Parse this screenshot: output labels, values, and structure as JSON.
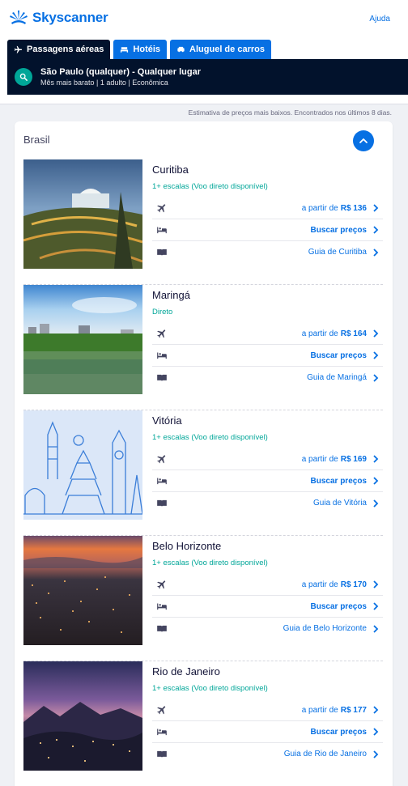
{
  "header": {
    "brand": "Skyscanner",
    "help_label": "Ajuda"
  },
  "tabs": [
    {
      "label": "Passagens aéreas",
      "icon": "plane-icon",
      "active": true
    },
    {
      "label": "Hotéis",
      "icon": "bed-icon",
      "active": false
    },
    {
      "label": "Aluguel de carros",
      "icon": "car-icon",
      "active": false
    }
  ],
  "search": {
    "route": "São Paulo (qualquer) - Qualquer lugar",
    "meta": "Mês mais barato | 1 adulto | Econômica"
  },
  "estimate_note": "Estimativa de preços mais baixos. Encontrados nos últimos 8 dias.",
  "country": "Brasil",
  "destinations": [
    {
      "city": "Curitiba",
      "stops": "1+ escalas (Voo direto disponível)",
      "price_prefix": "a partir de",
      "price": "R$ 136",
      "hotel_label": "Buscar preços",
      "guide_label": "Guia de Curitiba"
    },
    {
      "city": "Maringá",
      "stops": "Direto",
      "price_prefix": "a partir de",
      "price": "R$ 164",
      "hotel_label": "Buscar preços",
      "guide_label": "Guia de Maringá"
    },
    {
      "city": "Vitória",
      "stops": "1+ escalas (Voo direto disponível)",
      "price_prefix": "a partir de",
      "price": "R$ 169",
      "hotel_label": "Buscar preços",
      "guide_label": "Guia de Vitória"
    },
    {
      "city": "Belo Horizonte",
      "stops": "1+ escalas (Voo direto disponível)",
      "price_prefix": "a partir de",
      "price": "R$ 170",
      "hotel_label": "Buscar preços",
      "guide_label": "Guia de Belo Horizonte"
    },
    {
      "city": "Rio de Janeiro",
      "stops": "1+ escalas (Voo direto disponível)",
      "price_prefix": "a partir de",
      "price": "R$ 177",
      "hotel_label": "Buscar preços",
      "guide_label": "Guia de Rio de Janeiro"
    }
  ],
  "colors": {
    "brand": "#0770e3",
    "navy": "#02122c",
    "teal": "#00a698"
  }
}
